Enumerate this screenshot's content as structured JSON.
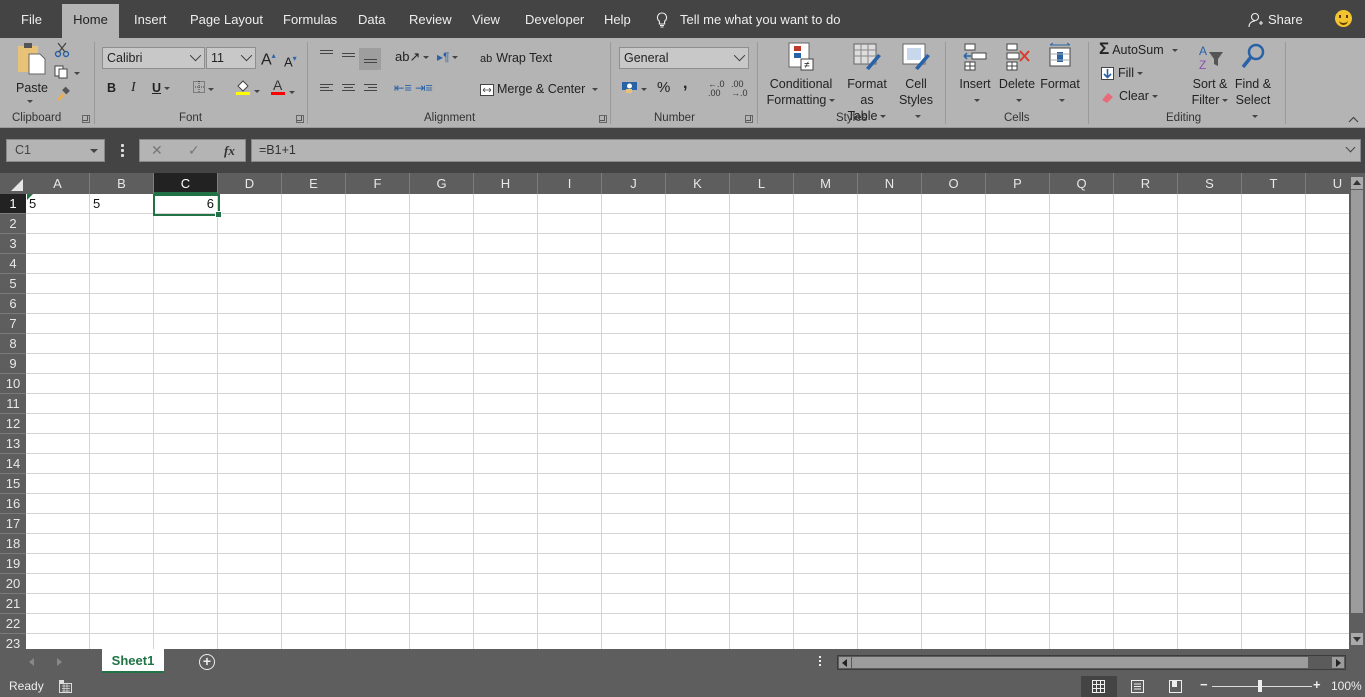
{
  "tabs": [
    {
      "label": "File",
      "active": false
    },
    {
      "label": "Home",
      "active": true
    },
    {
      "label": "Insert",
      "active": false
    },
    {
      "label": "Page Layout",
      "active": false
    },
    {
      "label": "Formulas",
      "active": false
    },
    {
      "label": "Data",
      "active": false
    },
    {
      "label": "Review",
      "active": false
    },
    {
      "label": "View",
      "active": false
    },
    {
      "label": "Developer",
      "active": false
    },
    {
      "label": "Help",
      "active": false
    }
  ],
  "tell_me": {
    "placeholder": "Tell me what you want to do",
    "icon": "lightbulb-icon"
  },
  "share": {
    "label": "Share",
    "icon": "person-add-icon"
  },
  "ribbon": {
    "clipboard": {
      "label": "Clipboard",
      "paste": "Paste"
    },
    "font": {
      "label": "Font",
      "font_name": "Calibri",
      "font_size": "11",
      "bold": "B",
      "italic": "I",
      "underline": "U",
      "highlight_color": "#ffff00",
      "font_color": "#ff0000"
    },
    "alignment": {
      "label": "Alignment",
      "wrap_text": "Wrap Text",
      "merge_center": "Merge & Center"
    },
    "number": {
      "label": "Number",
      "format": "General",
      "percent": "%",
      "comma": ","
    },
    "styles": {
      "label": "Styles",
      "conditional_formatting": [
        "Conditional",
        "Formatting"
      ],
      "format_as_table": [
        "Format as",
        "Table"
      ],
      "cell_styles": [
        "Cell",
        "Styles"
      ]
    },
    "cells": {
      "label": "Cells",
      "insert": "Insert",
      "delete": "Delete",
      "format": "Format"
    },
    "editing": {
      "label": "Editing",
      "autosum": "AutoSum",
      "fill": "Fill",
      "clear": "Clear",
      "sort_filter": [
        "Sort &",
        "Filter"
      ],
      "find_select": [
        "Find &",
        "Select"
      ]
    }
  },
  "formula_bar": {
    "name_box": "C1",
    "formula": "=B1+1",
    "fx": "fx"
  },
  "grid": {
    "columns": [
      "A",
      "B",
      "C",
      "D",
      "E",
      "F",
      "G",
      "H",
      "I",
      "J",
      "K",
      "L",
      "M",
      "N",
      "O",
      "P",
      "Q",
      "R",
      "S",
      "T",
      "U"
    ],
    "rows": [
      "1",
      "2",
      "3",
      "4",
      "5",
      "6",
      "7",
      "8",
      "9",
      "10",
      "11",
      "12",
      "13",
      "14",
      "15",
      "16",
      "17",
      "18",
      "19",
      "20",
      "21",
      "22",
      "23"
    ],
    "selected_cell": "C1",
    "cells": [
      {
        "ref": "A1",
        "value": "5",
        "align": "left"
      },
      {
        "ref": "B1",
        "value": "5",
        "align": "left"
      },
      {
        "ref": "C1",
        "value": "6",
        "align": "right"
      }
    ]
  },
  "sheets": [
    {
      "name": "Sheet1",
      "active": true
    }
  ],
  "status": {
    "mode": "Ready",
    "zoom": "100%",
    "zoom_level": 1.0
  },
  "colors": {
    "accent": "#217346",
    "dark_chrome": "#444444",
    "ribbon_bg": "#b4b4b4"
  }
}
